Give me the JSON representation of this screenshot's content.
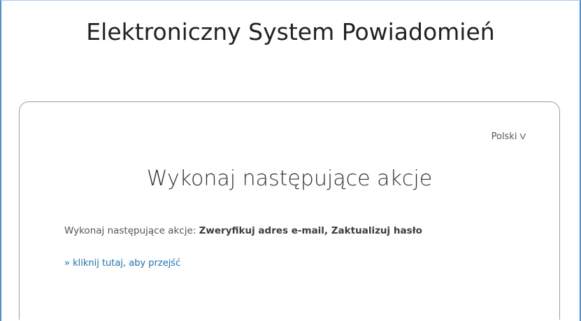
{
  "header": {
    "title": "Elektroniczny System Powiadomień"
  },
  "language": {
    "selected": "Polski",
    "chevron": "V",
    "icon": "chevron-down-icon"
  },
  "card": {
    "title": "Wykonaj następujące akcje",
    "actions_prefix": "Wykonaj następujące akcje:",
    "actions_list": "Zweryfikuj adres e-mail, Zaktualizuj hasło",
    "proceed_link": "» kliknij tutaj, aby przejść"
  },
  "colors": {
    "frame_border": "#4a90d9",
    "link": "#1a73c8",
    "card_border": "#9d9d9d"
  }
}
